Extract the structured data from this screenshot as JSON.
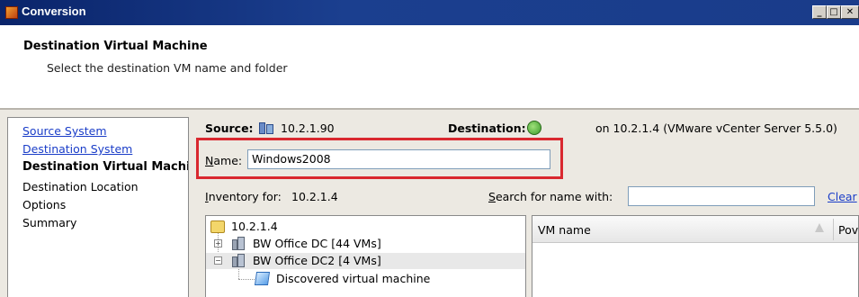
{
  "window": {
    "title": "Conversion",
    "minimize_glyph": "_",
    "maximize_glyph": "□",
    "close_glyph": "✕"
  },
  "header": {
    "title": "Destination Virtual Machine",
    "subtitle": "Select the destination VM name and folder"
  },
  "sidebar": {
    "items": [
      {
        "label": "Source System",
        "state": "link"
      },
      {
        "label": "Destination System",
        "state": "link"
      },
      {
        "label": "Destination Virtual Machi",
        "state": "active"
      },
      {
        "label": "Destination Location",
        "state": "normal"
      },
      {
        "label": "Options",
        "state": "normal"
      },
      {
        "label": "Summary",
        "state": "normal"
      }
    ]
  },
  "main": {
    "source_label": "Source:",
    "source_value": "10.2.1.90",
    "destination_label": "Destination:",
    "destination_value": "on 10.2.1.4 (VMware vCenter Server 5.5.0)",
    "name_label": "Name:",
    "name_value": "Windows2008",
    "inventory_label": "Inventory for:",
    "inventory_value": "10.2.1.4",
    "search_label": "Search for name with:",
    "search_value": "",
    "clear_label": "Clear"
  },
  "tree": {
    "root": "10.2.1.4",
    "nodes": [
      {
        "label": "BW Office DC [44 VMs]",
        "expander": "+"
      },
      {
        "label": "BW Office DC2 [4 VMs]",
        "expander": "−"
      },
      {
        "label": "Discovered virtual machine"
      }
    ]
  },
  "vm_list": {
    "columns": [
      "VM name",
      "Pov"
    ]
  },
  "colors": {
    "titlebar": "#0a246a",
    "highlight_outline": "#d9282f",
    "link": "#1a3dc8"
  },
  "icons": [
    "app-icon",
    "server-icon",
    "vcenter-icon",
    "folder-icon",
    "datacenter-icon",
    "vm-folder-icon",
    "sort-icon"
  ]
}
